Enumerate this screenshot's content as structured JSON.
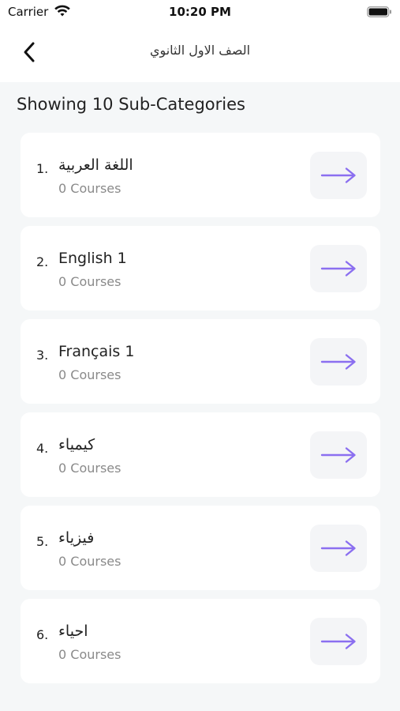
{
  "status_bar": {
    "carrier": "Carrier",
    "time": "10:20 PM",
    "wifi_icon": "wifi-icon",
    "battery_icon": "battery-icon"
  },
  "header": {
    "back_icon": "chevron-left-icon",
    "title": "الصف الاول الثانوي"
  },
  "summary": "Showing 10 Sub-Categories",
  "colors": {
    "accent": "#8b6ff0",
    "background": "#f5f7f8",
    "card": "#ffffff",
    "arrow_button": "#f4f5f7",
    "muted_text": "#8a8a8a"
  },
  "items": [
    {
      "num": "1.",
      "name": "اللغة العربية",
      "sub": "0 Courses"
    },
    {
      "num": "2.",
      "name": "English 1",
      "sub": "0 Courses"
    },
    {
      "num": "3.",
      "name": "Français 1",
      "sub": "0 Courses"
    },
    {
      "num": "4.",
      "name": "كيمياء",
      "sub": "0 Courses"
    },
    {
      "num": "5.",
      "name": "فيزياء",
      "sub": "0 Courses"
    },
    {
      "num": "6.",
      "name": "احياء",
      "sub": "0 Courses"
    }
  ]
}
